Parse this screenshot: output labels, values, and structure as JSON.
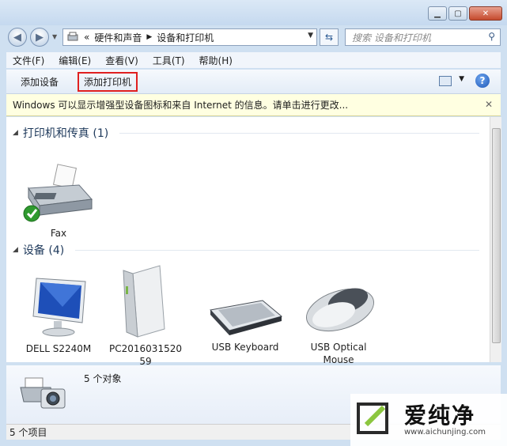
{
  "address": {
    "prefix": "«",
    "crumbs": [
      "硬件和声音",
      "设备和打印机"
    ]
  },
  "search": {
    "placeholder": "搜索 设备和打印机"
  },
  "menu": [
    "文件(F)",
    "编辑(E)",
    "查看(V)",
    "工具(T)",
    "帮助(H)"
  ],
  "commands": {
    "add_device": "添加设备",
    "add_printer": "添加打印机"
  },
  "infobar": {
    "text": "Windows 可以显示增强型设备图标和来自 Internet 的信息。请单击进行更改..."
  },
  "groups": [
    {
      "title": "打印机和传真 (1)",
      "devices": [
        {
          "label": "Fax",
          "icon": "fax-icon",
          "default": true
        }
      ]
    },
    {
      "title": "设备 (4)",
      "devices": [
        {
          "label": "DELL S2240M",
          "icon": "monitor-icon"
        },
        {
          "label": "PC201603152059",
          "icon": "pc-tower-icon"
        },
        {
          "label": "USB Keyboard",
          "icon": "keyboard-icon"
        },
        {
          "label": "USB Optical Mouse",
          "icon": "mouse-icon"
        }
      ]
    }
  ],
  "details": {
    "count": "5 个对象"
  },
  "status": {
    "text": "5 个项目"
  },
  "watermark": {
    "brand": "爱纯净",
    "url": "www.aichunjing.com"
  }
}
